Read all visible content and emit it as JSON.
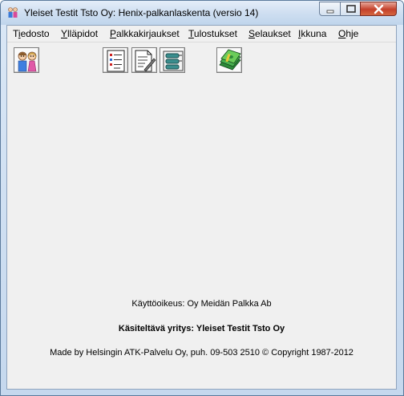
{
  "window": {
    "title": "Yleiset Testit Tsto Oy: Henix-palkanlaskenta (versio 14)"
  },
  "menu": {
    "items": [
      {
        "first": "T",
        "under": "i",
        "rest": "edosto"
      },
      {
        "first": "",
        "under": "Y",
        "rest": "lläpidot"
      },
      {
        "first": "",
        "under": "P",
        "rest": "alkkakirjaukset"
      },
      {
        "first": "",
        "under": "T",
        "rest": "ulostukset"
      },
      {
        "first": "",
        "under": "S",
        "rest": "elaukset"
      },
      {
        "first": "",
        "under": "I",
        "rest": "kkuna"
      },
      {
        "first": "",
        "under": "O",
        "rest": "hje"
      }
    ]
  },
  "toolbar": {
    "buttons": [
      {
        "icon": "people-icon"
      },
      {
        "icon": "checklist-icon"
      },
      {
        "icon": "document-edit-icon"
      },
      {
        "icon": "database-icon"
      },
      {
        "icon": "money-icon"
      }
    ]
  },
  "info": {
    "license": "Käyttöoikeus: Oy Meidän Palkka Ab",
    "company": "Käsiteltävä yritys: Yleiset Testit Tsto Oy",
    "copyright": "Made by Helsingin ATK-Palvelu Oy, puh. 09-503 2510 © Copyright 1987-2012"
  }
}
